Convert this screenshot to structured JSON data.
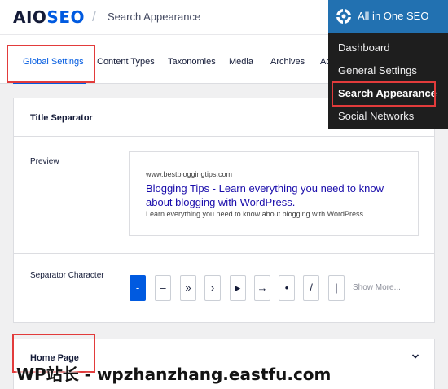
{
  "header": {
    "logo_main": "AIOSEO",
    "breadcrumb_sep": "/",
    "breadcrumb": "Search Appearance"
  },
  "tabs": [
    {
      "label": "Global Settings",
      "active": true
    },
    {
      "label": "Content Types"
    },
    {
      "label": "Taxonomies"
    },
    {
      "label": "Media"
    },
    {
      "label": "Archives"
    },
    {
      "label": "Ad"
    }
  ],
  "title_separator": {
    "title": "Title Separator",
    "preview_label": "Preview",
    "preview": {
      "url": "www.bestbloggingtips.com",
      "title": "Blogging Tips - Learn everything you need to know about blogging with WordPress.",
      "description": "Learn everything you need to know about blogging with WordPress."
    },
    "separator_label": "Separator Character",
    "separators": [
      "-",
      "–",
      "»",
      "›",
      "▸",
      "→",
      "•",
      "/",
      "|"
    ],
    "selected_index": 0,
    "show_more": "Show More..."
  },
  "home_page": {
    "title": "Home Page"
  },
  "admin_menu": {
    "title": "All in One SEO",
    "items": [
      "Dashboard",
      "General Settings",
      "Search Appearance",
      "Social Networks"
    ],
    "active_index": 2
  },
  "watermark": "WP站长 - wpzhanzhang.eastfu.com",
  "colors": {
    "brand_blue": "#005ae0",
    "menu_bg": "#1e1e1e",
    "menu_head": "#2271b1",
    "highlight_red": "#e23b3b",
    "link_blue": "#1a0dab"
  }
}
